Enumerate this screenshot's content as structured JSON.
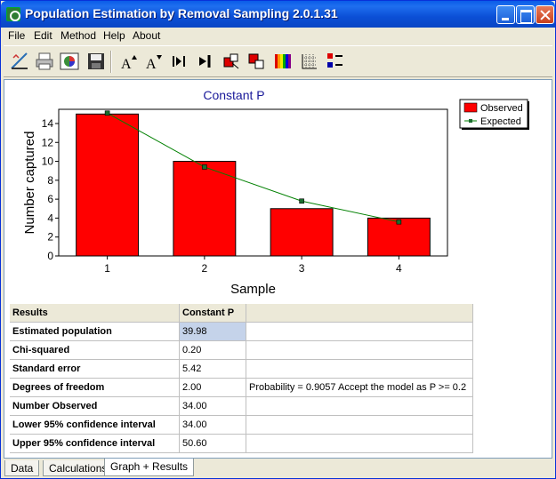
{
  "window": {
    "title": "Population Estimation by Removal Sampling 2.0.1.31"
  },
  "menu": [
    "File",
    "Edit",
    "Method",
    "Help",
    "About"
  ],
  "toolbar": {
    "buttons": [
      {
        "name": "ruler-icon"
      },
      {
        "name": "printer-icon"
      },
      {
        "name": "chart-palette-icon"
      },
      {
        "name": "save-icon"
      },
      {
        "name": "font-larger-icon"
      },
      {
        "name": "font-smaller-icon"
      },
      {
        "name": "bar-start-icon"
      },
      {
        "name": "bar-end-icon"
      },
      {
        "name": "grid-red-icon"
      },
      {
        "name": "grid-down-icon"
      },
      {
        "name": "color-bars-icon"
      },
      {
        "name": "grid-lines-icon"
      },
      {
        "name": "legend-icon"
      }
    ],
    "font_larger_glyph": "A",
    "font_smaller_glyph": "A"
  },
  "chart_data": {
    "type": "bar",
    "title": "Constant P",
    "xlabel": "Sample",
    "ylabel": "Number captured",
    "categories": [
      "1",
      "2",
      "3",
      "4"
    ],
    "ylim": [
      0,
      15.5
    ],
    "yticks": [
      0,
      2,
      4,
      6,
      8,
      10,
      12,
      14
    ],
    "series": [
      {
        "name": "Observed",
        "type": "bar",
        "color": "#ff0000",
        "values": [
          15,
          10,
          5,
          4
        ]
      },
      {
        "name": "Expected",
        "type": "line",
        "color": "#008000",
        "values": [
          15.1,
          9.4,
          5.8,
          3.6
        ]
      }
    ],
    "legend": "top-right"
  },
  "results": {
    "headers": [
      "Results",
      "Constant P",
      ""
    ],
    "rows": [
      [
        "Estimated population",
        "39.98",
        ""
      ],
      [
        "Chi-squared",
        "0.20",
        ""
      ],
      [
        "Standard error",
        "5.42",
        ""
      ],
      [
        "Degrees of freedom",
        "2.00",
        "Probability = 0.9057  Accept the model as P >= 0.2"
      ],
      [
        "Number Observed",
        "34.00",
        ""
      ],
      [
        "Lower 95% confidence interval",
        "34.00",
        ""
      ],
      [
        "Upper 95% confidence interval",
        "50.60",
        ""
      ]
    ]
  },
  "tabs": [
    "Data",
    "Calculations",
    "Graph + Results"
  ],
  "active_tab": "Graph + Results"
}
